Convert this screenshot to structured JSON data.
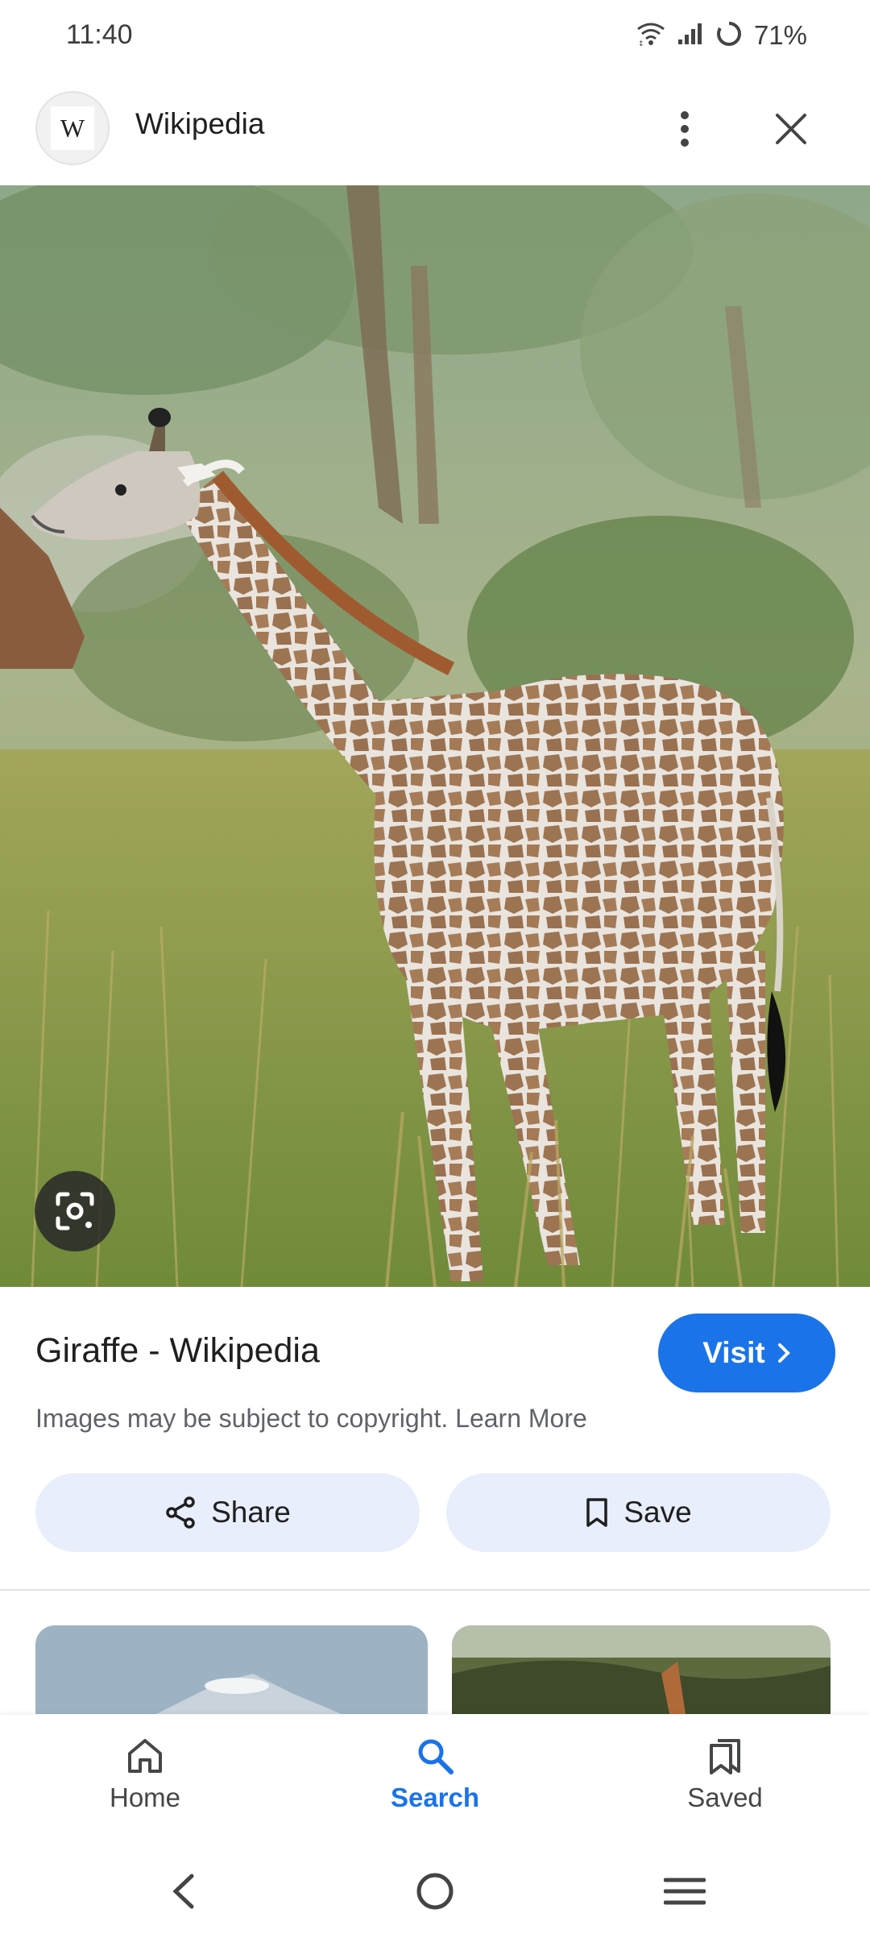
{
  "status_bar": {
    "time": "11:40",
    "battery": "71%",
    "icons": [
      "wifi-icon",
      "signal-icon",
      "battery-ring-icon"
    ]
  },
  "header": {
    "site_logo_letter": "W",
    "site_name": "Wikipedia",
    "icons": [
      "more-vert-icon",
      "close-icon"
    ]
  },
  "image": {
    "subject": "giraffe-photo"
  },
  "result": {
    "title": "Giraffe - Wikipedia",
    "visit_label": "Visit",
    "copyright_text": "Images may be subject to copyright.",
    "learn_more": "Learn More",
    "share_label": "Share",
    "save_label": "Save"
  },
  "bottom_nav": {
    "items": [
      {
        "label": "Home",
        "icon": "home-icon"
      },
      {
        "label": "Search",
        "icon": "search-icon",
        "active": true
      },
      {
        "label": "Saved",
        "icon": "saved-icon"
      }
    ]
  },
  "colors": {
    "accent": "#1a73e8",
    "pill_bg": "#e8eefc",
    "text_secondary": "#5f6368"
  }
}
